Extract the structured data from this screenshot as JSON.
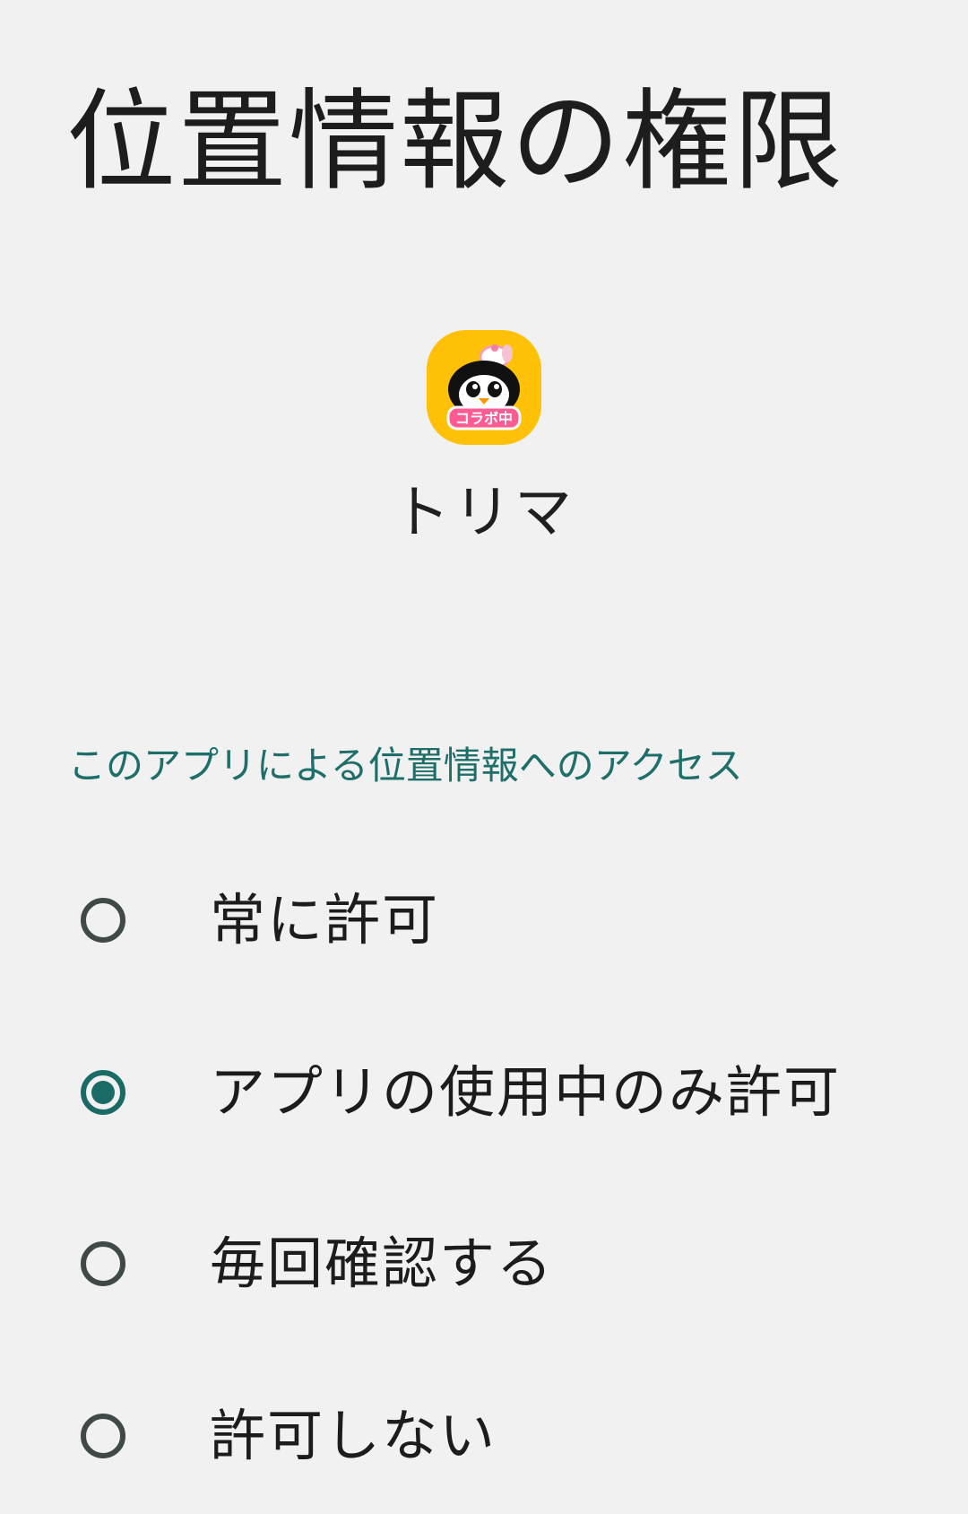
{
  "title": "位置情報の権限",
  "app": {
    "name": "トリマ",
    "icon": "penguin-app-icon",
    "icon_badge": "コラボ中",
    "icon_bg_color": "#ffc107"
  },
  "section_label": "このアプリによる位置情報へのアクセス",
  "options": [
    {
      "label": "常に許可",
      "selected": false
    },
    {
      "label": "アプリの使用中のみ許可",
      "selected": true
    },
    {
      "label": "毎回確認する",
      "selected": false
    },
    {
      "label": "許可しない",
      "selected": false
    }
  ],
  "colors": {
    "accent": "#1a6b66",
    "radio_unchecked": "#3f4947",
    "background": "#f0f1f0",
    "section_label": "#1e6e6a"
  }
}
